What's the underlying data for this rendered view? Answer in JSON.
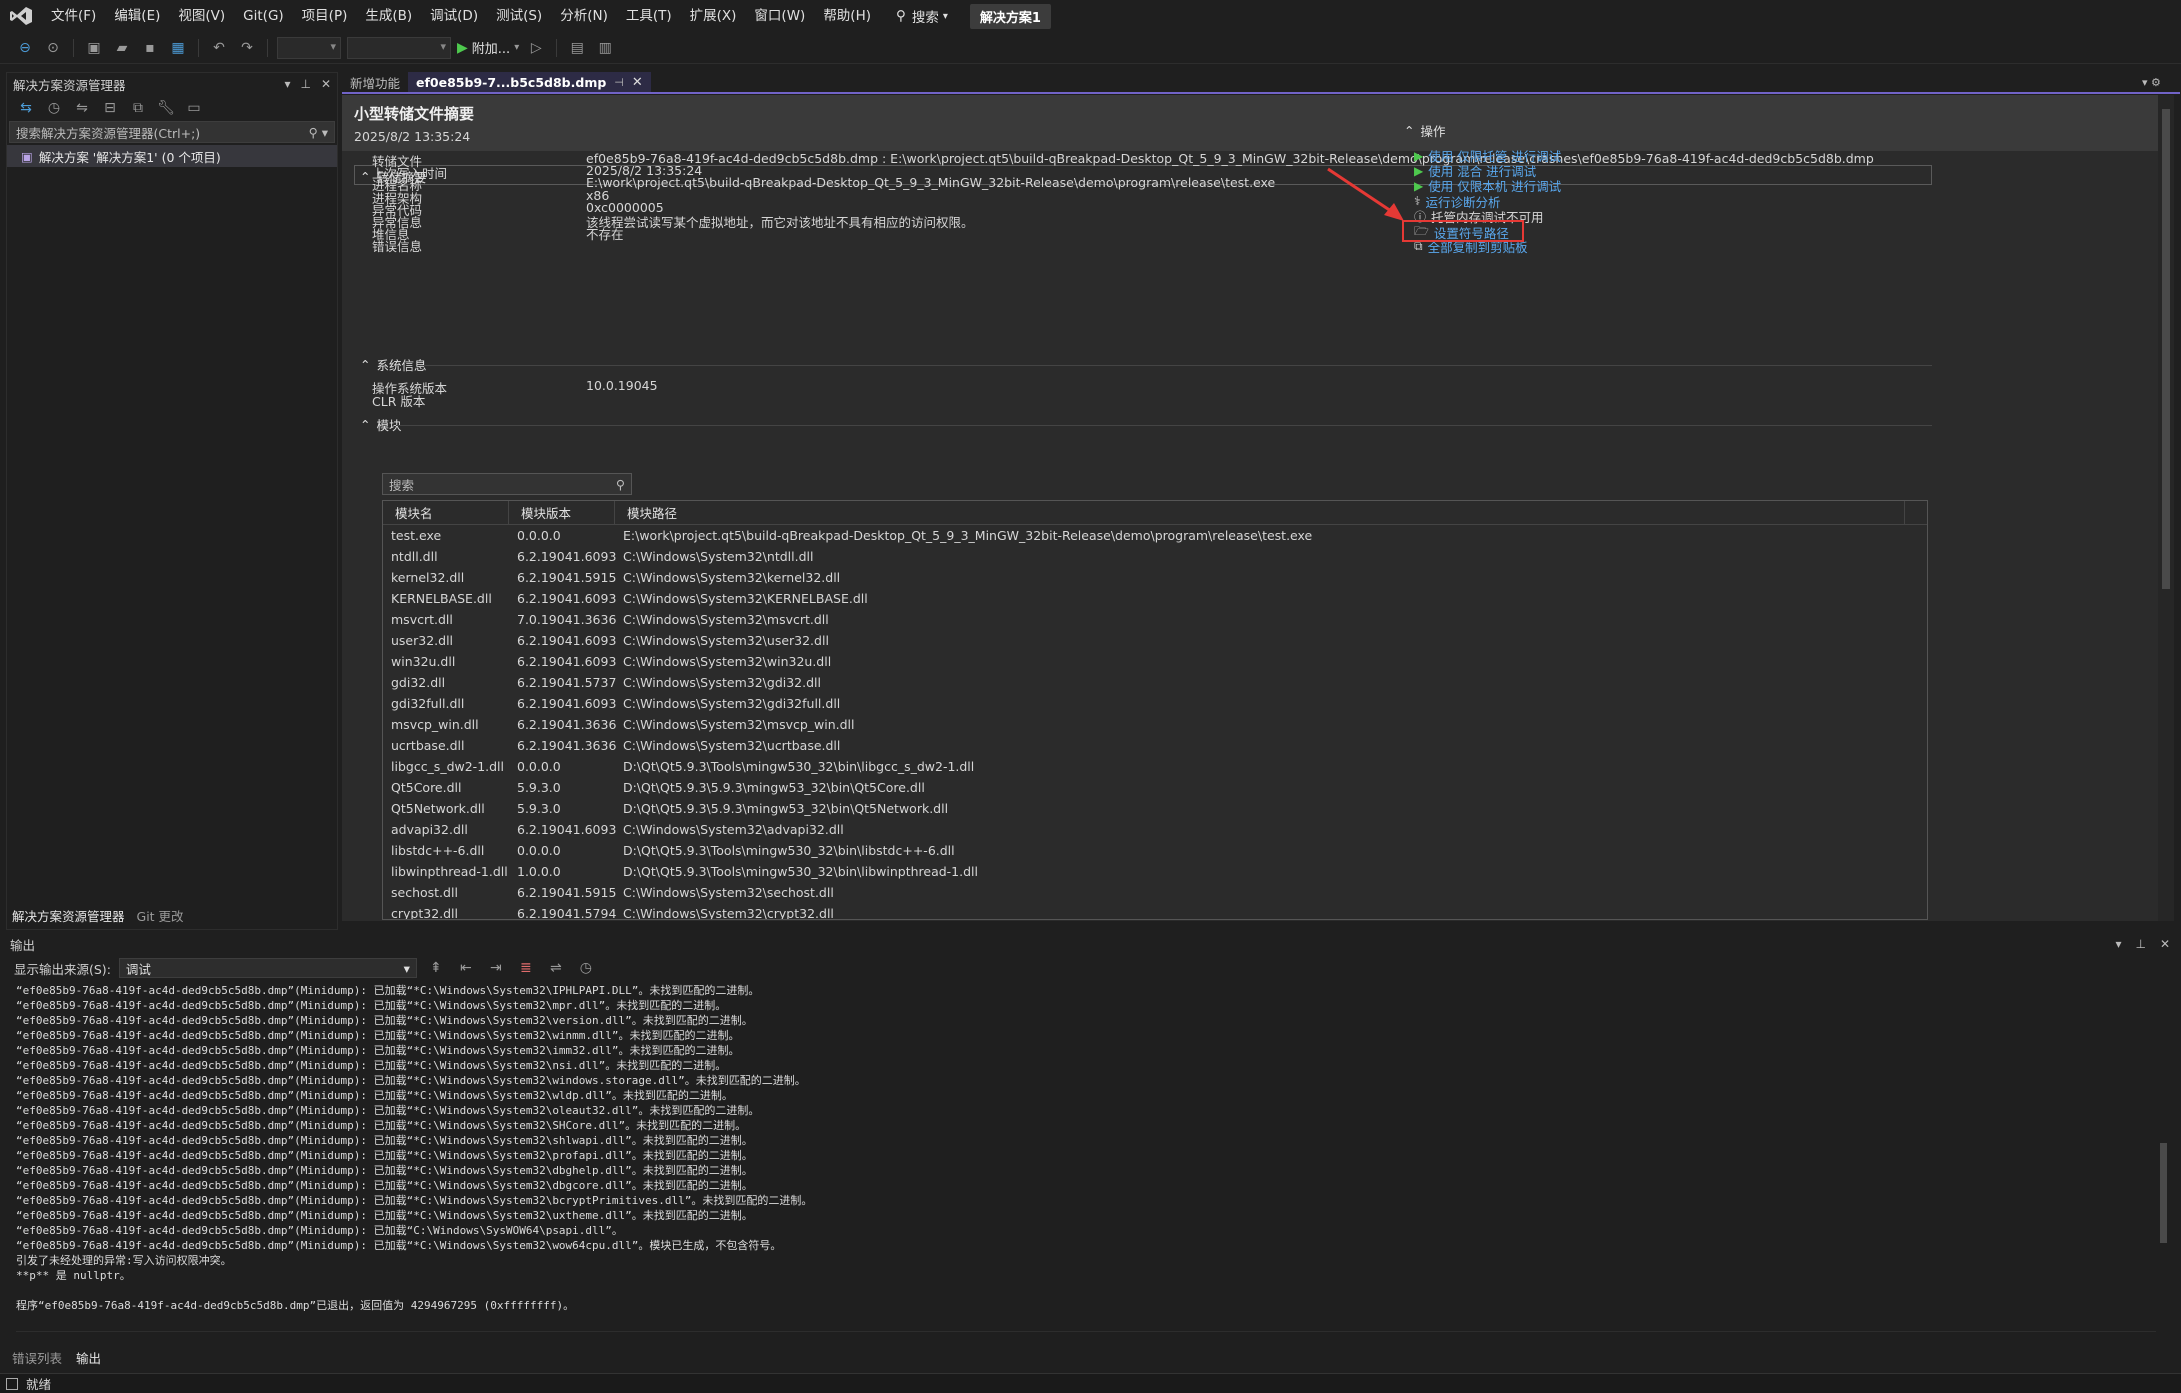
{
  "menu": {
    "items": [
      "文件(F)",
      "编辑(E)",
      "视图(V)",
      "Git(G)",
      "项目(P)",
      "生成(B)",
      "调试(D)",
      "测试(S)",
      "分析(N)",
      "工具(T)",
      "扩展(X)",
      "窗口(W)",
      "帮助(H)"
    ],
    "search_label": "搜索",
    "solution_name": "解决方案1"
  },
  "toolbar": {
    "attach_label": "附加..."
  },
  "solution_explorer": {
    "title": "解决方案资源管理器",
    "search_placeholder": "搜索解决方案资源管理器(Ctrl+;)",
    "tree_item": "解决方案 '解决方案1' (0 个项目)",
    "tab_active": "解决方案资源管理器",
    "tab_inactive": "Git 更改"
  },
  "doc_tabs": {
    "inactive_tab": "新增功能",
    "active_tab": "ef0e85b9-7...b5c5d8b.dmp"
  },
  "dump": {
    "title": "小型转储文件摘要",
    "date": "2025/8/2 13:35:24",
    "summary_section": "转储摘要",
    "summary": [
      {
        "key": "转储文件",
        "value": "ef0e85b9-76a8-419f-ac4d-ded9cb5c5d8b.dmp : E:\\work\\project.qt5\\build-qBreakpad-Desktop_Qt_5_9_3_MinGW_32bit-Release\\demo\\program\\release\\crashes\\ef0e85b9-76a8-419f-ac4d-ded9cb5c5d8b.dmp"
      },
      {
        "key": "上次写入时间",
        "value": "2025/8/2 13:35:24"
      },
      {
        "key": "进程名称",
        "value": "E:\\work\\project.qt5\\build-qBreakpad-Desktop_Qt_5_9_3_MinGW_32bit-Release\\demo\\program\\release\\test.exe"
      },
      {
        "key": "进程架构",
        "value": "x86"
      },
      {
        "key": "异常代码",
        "value": "0xc0000005"
      },
      {
        "key": "异常信息",
        "value": "该线程尝试读写某个虚拟地址，而它对该地址不具有相应的访问权限。"
      },
      {
        "key": "堆信息",
        "value": "不存在"
      },
      {
        "key": "错误信息",
        "value": ""
      }
    ],
    "system_section": "系统信息",
    "system": [
      {
        "key": "操作系统版本",
        "value": "10.0.19045"
      },
      {
        "key": "CLR 版本",
        "value": ""
      }
    ],
    "modules_section": "模块",
    "modules_search_placeholder": "搜索",
    "modules_columns": [
      "模块名",
      "模块版本",
      "模块路径"
    ],
    "modules": [
      [
        "test.exe",
        "0.0.0.0",
        "E:\\work\\project.qt5\\build-qBreakpad-Desktop_Qt_5_9_3_MinGW_32bit-Release\\demo\\program\\release\\test.exe"
      ],
      [
        "ntdll.dll",
        "6.2.19041.6093",
        "C:\\Windows\\System32\\ntdll.dll"
      ],
      [
        "kernel32.dll",
        "6.2.19041.5915",
        "C:\\Windows\\System32\\kernel32.dll"
      ],
      [
        "KERNELBASE.dll",
        "6.2.19041.6093",
        "C:\\Windows\\System32\\KERNELBASE.dll"
      ],
      [
        "msvcrt.dll",
        "7.0.19041.3636",
        "C:\\Windows\\System32\\msvcrt.dll"
      ],
      [
        "user32.dll",
        "6.2.19041.6093",
        "C:\\Windows\\System32\\user32.dll"
      ],
      [
        "win32u.dll",
        "6.2.19041.6093",
        "C:\\Windows\\System32\\win32u.dll"
      ],
      [
        "gdi32.dll",
        "6.2.19041.5737",
        "C:\\Windows\\System32\\gdi32.dll"
      ],
      [
        "gdi32full.dll",
        "6.2.19041.6093",
        "C:\\Windows\\System32\\gdi32full.dll"
      ],
      [
        "msvcp_win.dll",
        "6.2.19041.3636",
        "C:\\Windows\\System32\\msvcp_win.dll"
      ],
      [
        "ucrtbase.dll",
        "6.2.19041.3636",
        "C:\\Windows\\System32\\ucrtbase.dll"
      ],
      [
        "libgcc_s_dw2-1.dll",
        "0.0.0.0",
        "D:\\Qt\\Qt5.9.3\\Tools\\mingw530_32\\bin\\libgcc_s_dw2-1.dll"
      ],
      [
        "Qt5Core.dll",
        "5.9.3.0",
        "D:\\Qt\\Qt5.9.3\\5.9.3\\mingw53_32\\bin\\Qt5Core.dll"
      ],
      [
        "Qt5Network.dll",
        "5.9.3.0",
        "D:\\Qt\\Qt5.9.3\\5.9.3\\mingw53_32\\bin\\Qt5Network.dll"
      ],
      [
        "advapi32.dll",
        "6.2.19041.6093",
        "C:\\Windows\\System32\\advapi32.dll"
      ],
      [
        "libstdc++-6.dll",
        "0.0.0.0",
        "D:\\Qt\\Qt5.9.3\\Tools\\mingw530_32\\bin\\libstdc++-6.dll"
      ],
      [
        "libwinpthread-1.dll",
        "1.0.0.0",
        "D:\\Qt\\Qt5.9.3\\Tools\\mingw530_32\\bin\\libwinpthread-1.dll"
      ],
      [
        "sechost.dll",
        "6.2.19041.5915",
        "C:\\Windows\\System32\\sechost.dll"
      ],
      [
        "crypt32.dll",
        "6.2.19041.5794",
        "C:\\Windows\\System32\\crypt32.dll"
      ]
    ]
  },
  "actions": {
    "title": "操作",
    "items": [
      {
        "label": "使用 仅限托管 进行调试",
        "icon": "play-icon",
        "enabled": true
      },
      {
        "label": "使用 混合 进行调试",
        "icon": "play-icon",
        "enabled": true
      },
      {
        "label": "使用 仅限本机 进行调试",
        "icon": "play-icon",
        "enabled": true
      },
      {
        "label": "运行诊断分析",
        "icon": "diagnostics-icon",
        "enabled": true
      },
      {
        "label": "托管内存调试不可用",
        "icon": "info-icon",
        "enabled": false
      },
      {
        "label": "设置符号路径",
        "icon": "folder-icon",
        "enabled": true
      },
      {
        "label": "全部复制到剪贴板",
        "icon": "copy-icon",
        "enabled": true
      }
    ]
  },
  "output": {
    "title": "输出",
    "source_label": "显示输出来源(S):",
    "source_value": "调试",
    "lines": [
      "“ef0e85b9-76a8-419f-ac4d-ded9cb5c5d8b.dmp”(Minidump): 已加载“*C:\\Windows\\System32\\IPHLPAPI.DLL”。未找到匹配的二进制。",
      "“ef0e85b9-76a8-419f-ac4d-ded9cb5c5d8b.dmp”(Minidump): 已加载“*C:\\Windows\\System32\\mpr.dll”。未找到匹配的二进制。",
      "“ef0e85b9-76a8-419f-ac4d-ded9cb5c5d8b.dmp”(Minidump): 已加载“*C:\\Windows\\System32\\version.dll”。未找到匹配的二进制。",
      "“ef0e85b9-76a8-419f-ac4d-ded9cb5c5d8b.dmp”(Minidump): 已加载“*C:\\Windows\\System32\\winmm.dll”。未找到匹配的二进制。",
      "“ef0e85b9-76a8-419f-ac4d-ded9cb5c5d8b.dmp”(Minidump): 已加载“*C:\\Windows\\System32\\imm32.dll”。未找到匹配的二进制。",
      "“ef0e85b9-76a8-419f-ac4d-ded9cb5c5d8b.dmp”(Minidump): 已加载“*C:\\Windows\\System32\\nsi.dll”。未找到匹配的二进制。",
      "“ef0e85b9-76a8-419f-ac4d-ded9cb5c5d8b.dmp”(Minidump): 已加载“*C:\\Windows\\System32\\windows.storage.dll”。未找到匹配的二进制。",
      "“ef0e85b9-76a8-419f-ac4d-ded9cb5c5d8b.dmp”(Minidump): 已加载“*C:\\Windows\\System32\\wldp.dll”。未找到匹配的二进制。",
      "“ef0e85b9-76a8-419f-ac4d-ded9cb5c5d8b.dmp”(Minidump): 已加载“*C:\\Windows\\System32\\oleaut32.dll”。未找到匹配的二进制。",
      "“ef0e85b9-76a8-419f-ac4d-ded9cb5c5d8b.dmp”(Minidump): 已加载“*C:\\Windows\\System32\\SHCore.dll”。未找到匹配的二进制。",
      "“ef0e85b9-76a8-419f-ac4d-ded9cb5c5d8b.dmp”(Minidump): 已加载“*C:\\Windows\\System32\\shlwapi.dll”。未找到匹配的二进制。",
      "“ef0e85b9-76a8-419f-ac4d-ded9cb5c5d8b.dmp”(Minidump): 已加载“*C:\\Windows\\System32\\profapi.dll”。未找到匹配的二进制。",
      "“ef0e85b9-76a8-419f-ac4d-ded9cb5c5d8b.dmp”(Minidump): 已加载“*C:\\Windows\\System32\\dbghelp.dll”。未找到匹配的二进制。",
      "“ef0e85b9-76a8-419f-ac4d-ded9cb5c5d8b.dmp”(Minidump): 已加载“*C:\\Windows\\System32\\dbgcore.dll”。未找到匹配的二进制。",
      "“ef0e85b9-76a8-419f-ac4d-ded9cb5c5d8b.dmp”(Minidump): 已加载“*C:\\Windows\\System32\\bcryptPrimitives.dll”。未找到匹配的二进制。",
      "“ef0e85b9-76a8-419f-ac4d-ded9cb5c5d8b.dmp”(Minidump): 已加载“*C:\\Windows\\System32\\uxtheme.dll”。未找到匹配的二进制。",
      "“ef0e85b9-76a8-419f-ac4d-ded9cb5c5d8b.dmp”(Minidump): 已加载“C:\\Windows\\SysWOW64\\psapi.dll”。",
      "“ef0e85b9-76a8-419f-ac4d-ded9cb5c5d8b.dmp”(Minidump): 已加载“*C:\\Windows\\System32\\wow64cpu.dll”。模块已生成，不包含符号。",
      "引发了未经处理的异常:写入访问权限冲突。",
      "**p** 是 nullptr。",
      "",
      "程序“ef0e85b9-76a8-419f-ac4d-ded9cb5c5d8b.dmp”已退出，返回值为 4294967295 (0xffffffff)。"
    ]
  },
  "bottom_tabs": {
    "error_list": "错误列表",
    "output": "输出"
  },
  "status": {
    "text": "就绪"
  },
  "colors": {
    "accent": "#7163c7",
    "link": "#5aa8ee",
    "highlight_box": "#e53935"
  }
}
